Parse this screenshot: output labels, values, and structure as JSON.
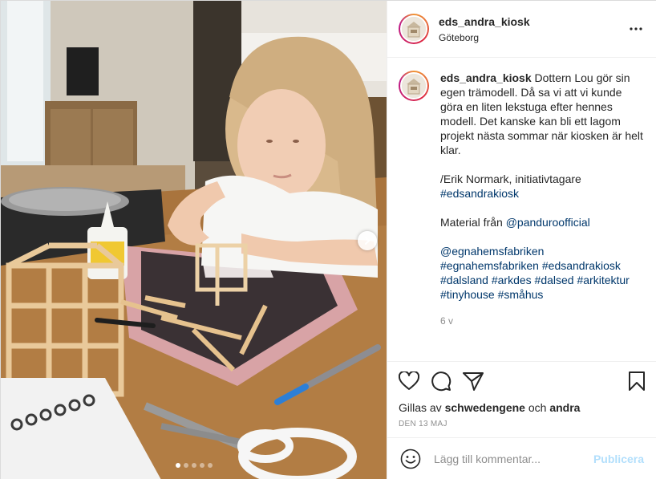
{
  "header": {
    "username": "eds_andra_kiosk",
    "location": "Göteborg",
    "more_icon": "more-horizontal-icon"
  },
  "caption": {
    "username": "eds_andra_kiosk",
    "text": " Dottern Lou gör sin egen trämodell. Då sa vi att vi kunde göra en liten lekstuga efter hennes modell. Det kanske kan bli ett lagom projekt nästa sommar när kiosken är helt klar.",
    "signature": "/Erik Normark, initiativtagare",
    "hashtag_1": "#edsandrakiosk",
    "material_prefix": "Material från ",
    "material_mention": "@panduroofficial",
    "tags": [
      "@egnahemsfabriken",
      "#egnahemsfabriken",
      "#edsandrakiosk",
      "#dalsland",
      "#arkdes",
      "#dalsed",
      "#arkitektur",
      "#tinyhouse",
      "#småhus"
    ],
    "time": "6 v"
  },
  "actions": {
    "like_icon": "heart-icon",
    "comment_icon": "comment-icon",
    "share_icon": "paper-plane-icon",
    "save_icon": "bookmark-icon"
  },
  "likes": {
    "prefix": "Gillas av ",
    "user": "schwedengene",
    "mid": " och ",
    "others": "andra"
  },
  "date": "DEN 13 MAJ",
  "add_comment": {
    "placeholder": "Lägg till kommentar...",
    "publish": "Publicera",
    "emoji_icon": "emoji-icon"
  },
  "carousel": {
    "count": 5,
    "active_index": 0,
    "next_icon": "chevron-right-icon"
  },
  "colors": {
    "link": "#00376b",
    "muted": "#8e8e8e",
    "publish_disabled": "#b2dffc"
  }
}
